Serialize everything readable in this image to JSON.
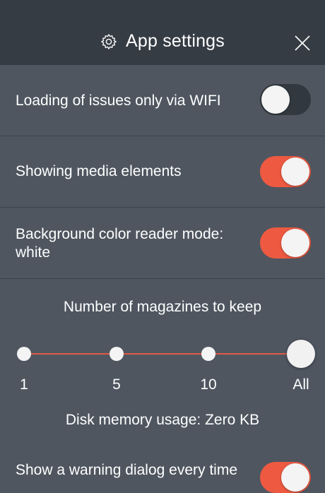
{
  "header": {
    "title": "App settings",
    "close_icon": "close-icon",
    "settings_icon": "gear-icon"
  },
  "settings": [
    {
      "label": "Loading of issues only via WIFI",
      "enabled": false
    },
    {
      "label": "Showing media elements",
      "enabled": true
    },
    {
      "label": "Background color reader mode: white",
      "enabled": true
    },
    {
      "label": "Show a warning dialog every time",
      "enabled": true
    }
  ],
  "magazines": {
    "title": "Number of magazines to keep",
    "options": [
      "1",
      "5",
      "10",
      "All"
    ],
    "selected": "All",
    "disk_usage": "Disk memory usage: Zero KB"
  },
  "colors": {
    "accent": "#ee5a41",
    "header_bg": "#363c44",
    "panel_bg": "#4f5660"
  }
}
